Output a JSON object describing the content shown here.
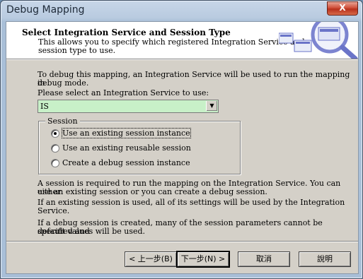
{
  "window": {
    "title": "Debug Mapping",
    "close_glyph": "X"
  },
  "header": {
    "title": "Select Integration Service and Session Type",
    "description": "This allows you to specify which registered Integration Service and session type to use."
  },
  "intro": {
    "line1": "To debug this mapping, an Integration Service will be used to run the mapping in",
    "line2": "debug mode.",
    "prompt": "Please select an Integration Service to use:"
  },
  "service_select": {
    "value": "IS"
  },
  "session_group": {
    "label": "Session",
    "options": [
      {
        "label": "Use an existing session instance",
        "selected": true
      },
      {
        "label": "Use an existing reusable session",
        "selected": false
      },
      {
        "label": "Create a debug session instance",
        "selected": false
      }
    ]
  },
  "notes": {
    "p1_line1": "A session is required to run the mapping on the Integration Service.  You can either",
    "p1_line2": "use an existing session or you can create a debug session.",
    "p2": "If an existing session is used, all of its settings will be used by the Integration Service.",
    "p3_line1": "If a debug session is created, many of the session parameters cannot be specified and",
    "p3_line2": "default values will be used."
  },
  "buttons": {
    "back": "< 上一步(B)",
    "next": "下一步(N) >",
    "cancel": "取消",
    "help": "說明"
  },
  "colors": {
    "combo_bg": "#c8f0c8",
    "dialog_bg": "#d4d0c8"
  }
}
